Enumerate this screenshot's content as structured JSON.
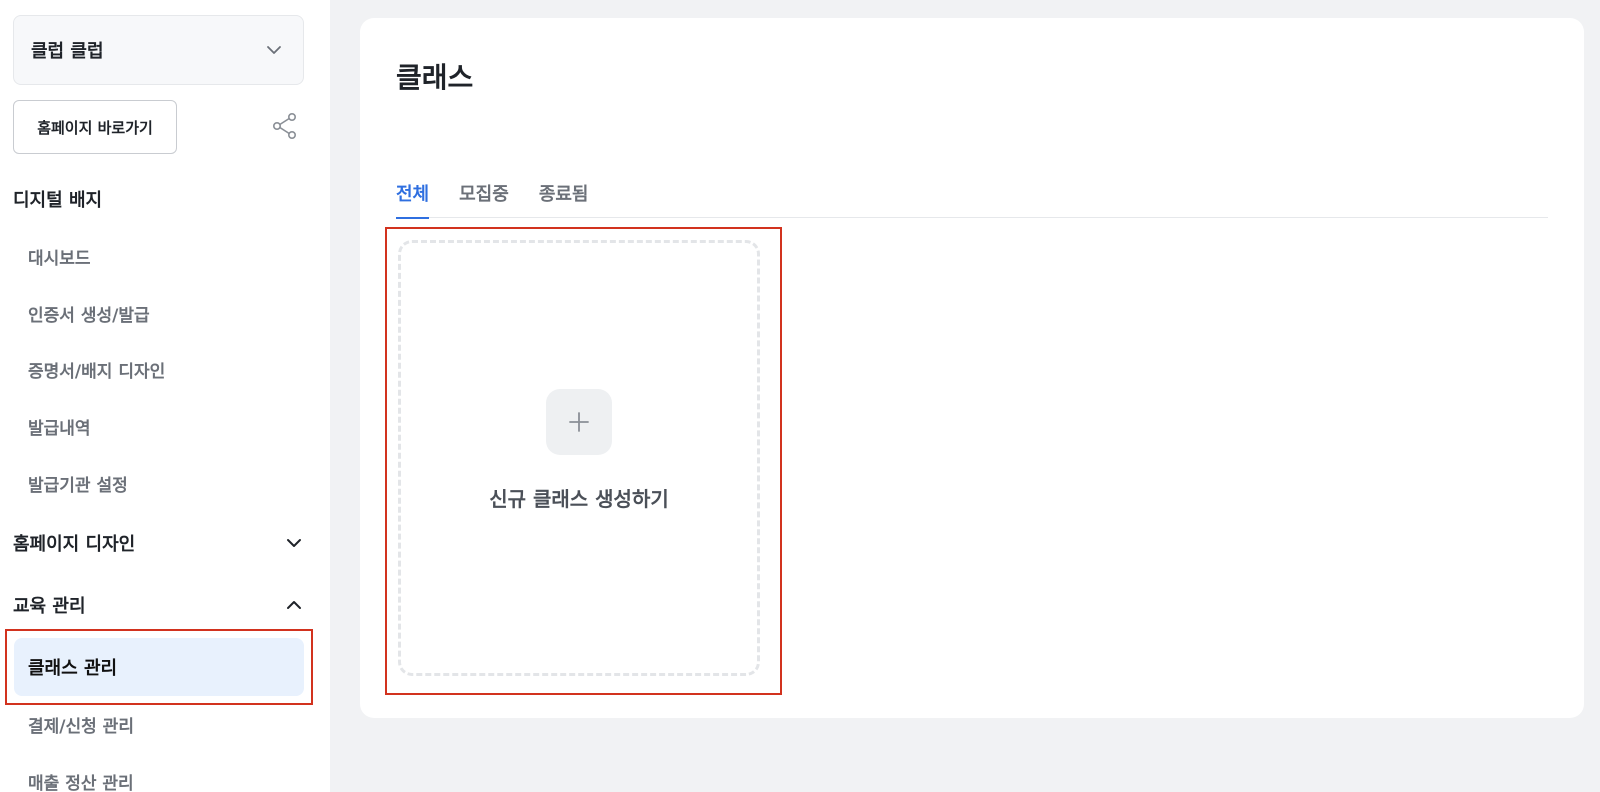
{
  "sidebar": {
    "org_name": "클럽 클럽",
    "home_button": "홈페이지 바로가기",
    "sections": {
      "digital_badge": {
        "label": "디지털 배지",
        "items": [
          "대시보드",
          "인증서 생성/발급",
          "증명서/배지 디자인",
          "발급내역",
          "발급기관 설정"
        ]
      },
      "homepage_design": {
        "label": "홈페이지 디자인"
      },
      "education": {
        "label": "교육 관리",
        "active_item": "클래스 관리",
        "items": [
          "결제/신청 관리",
          "매출 정산 관리"
        ]
      }
    }
  },
  "main": {
    "title": "클래스",
    "tabs": [
      {
        "label": "전체",
        "active": true
      },
      {
        "label": "모집중",
        "active": false
      },
      {
        "label": "종료됨",
        "active": false
      }
    ],
    "new_class_label": "신규 클래스 생성하기"
  },
  "colors": {
    "accent": "#2f6fe0",
    "active_bg": "#e8f1fd",
    "highlight": "#d2321e"
  },
  "icons": {
    "org_dropdown": "chevron-down-icon",
    "share": "share-icon",
    "plus": "plus-icon"
  }
}
